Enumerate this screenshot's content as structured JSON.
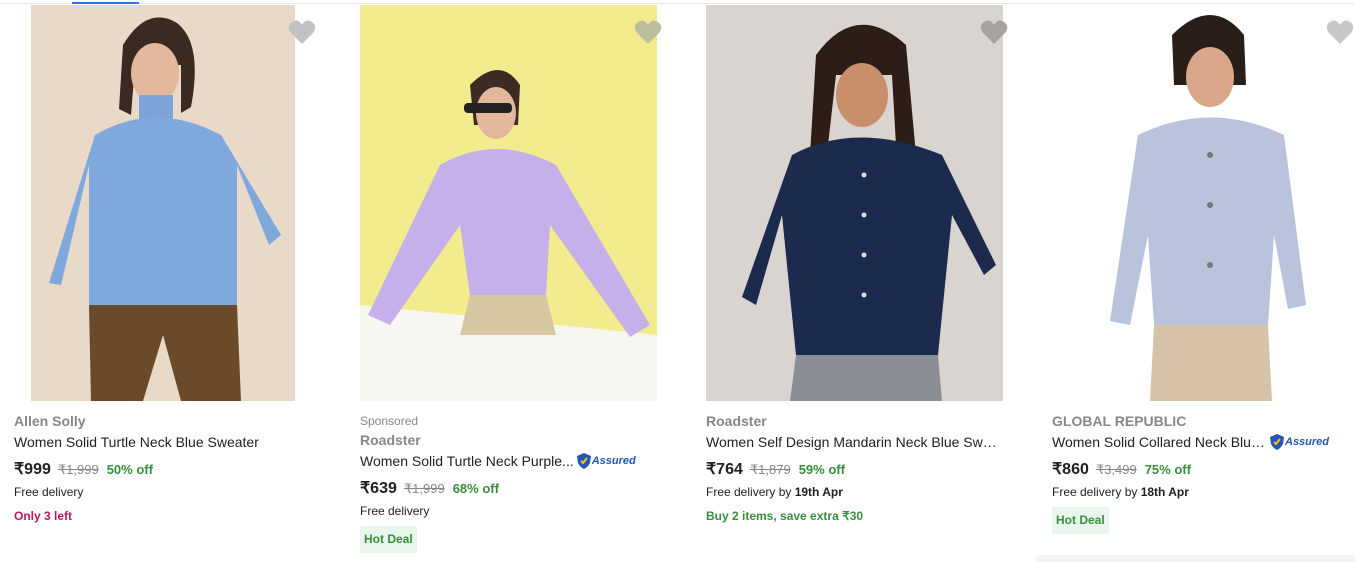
{
  "products": [
    {
      "sponsored": "",
      "brand": "Allen Solly",
      "title": "Women Solid Turtle Neck Blue Sweater",
      "assured": false,
      "price": "₹999",
      "mrp": "₹1,999",
      "discount": "50% off",
      "delivery_text": "Free delivery",
      "delivery_date": "",
      "urgency": "Only 3 left",
      "urgency_style": "pink",
      "hot_deal": ""
    },
    {
      "sponsored": "Sponsored",
      "brand": "Roadster",
      "title": "Women Solid Turtle Neck Purple...",
      "assured": true,
      "price": "₹639",
      "mrp": "₹1,999",
      "discount": "68% off",
      "delivery_text": "Free delivery",
      "delivery_date": "",
      "urgency": "",
      "urgency_style": "",
      "hot_deal": "Hot Deal"
    },
    {
      "sponsored": "",
      "brand": "Roadster",
      "title": "Women Self Design Mandarin Neck Blue Swe...",
      "assured": false,
      "price": "₹764",
      "mrp": "₹1,879",
      "discount": "59% off",
      "delivery_text": "Free delivery by ",
      "delivery_date": "19th Apr",
      "urgency": "Buy 2 items, save extra ₹30",
      "urgency_style": "green",
      "hot_deal": ""
    },
    {
      "sponsored": "",
      "brand": "GLOBAL REPUBLIC",
      "title": "Women Solid Collared Neck Blue...",
      "assured": true,
      "price": "₹860",
      "mrp": "₹3,499",
      "discount": "75% off",
      "delivery_text": "Free delivery by ",
      "delivery_date": "18th Apr",
      "urgency": "",
      "urgency_style": "",
      "hot_deal": "Hot Deal"
    }
  ],
  "assured_label": "Assured",
  "icons": {
    "wishlist": "heart-icon",
    "assured": "shield-icon"
  },
  "colors": {
    "accent": "#2874f0",
    "discount": "#388e3c",
    "urgency": "#c2185b",
    "muted": "#878787"
  }
}
